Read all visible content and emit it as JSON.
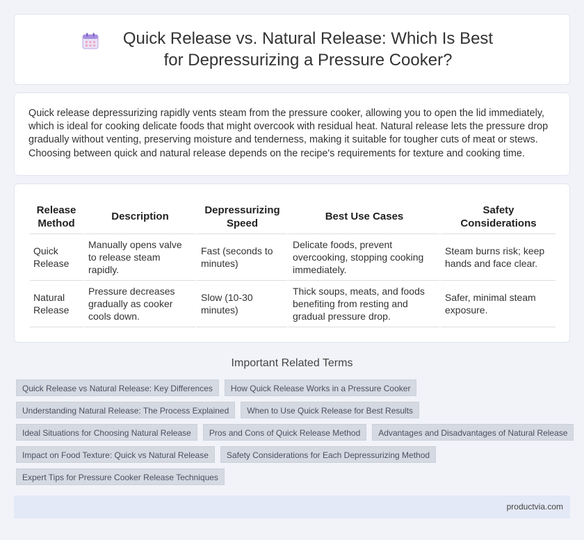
{
  "header": {
    "icon": "calendar-icon",
    "title": "Quick Release vs. Natural Release: Which Is Best for Depressurizing a Pressure Cooker?"
  },
  "intro": {
    "text": "Quick release depressurizing rapidly vents steam from the pressure cooker, allowing you to open the lid immediately, which is ideal for cooking delicate foods that might overcook with residual heat. Natural release lets the pressure drop gradually without venting, preserving moisture and tenderness, making it suitable for tougher cuts of meat or stews. Choosing between quick and natural release depends on the recipe's requirements for texture and cooking time."
  },
  "table": {
    "headers": [
      "Release Method",
      "Description",
      "Depressurizing Speed",
      "Best Use Cases",
      "Safety Considerations"
    ],
    "rows": [
      [
        "Quick Release",
        "Manually opens valve to release steam rapidly.",
        "Fast (seconds to minutes)",
        "Delicate foods, prevent overcooking, stopping cooking immediately.",
        "Steam burns risk; keep hands and face clear."
      ],
      [
        "Natural Release",
        "Pressure decreases gradually as cooker cools down.",
        "Slow (10-30 minutes)",
        "Thick soups, meats, and foods benefiting from resting and gradual pressure drop.",
        "Safer, minimal steam exposure."
      ]
    ]
  },
  "related": {
    "title": "Important Related Terms",
    "rows": [
      [
        "Quick Release vs Natural Release: Key Differences",
        "How Quick Release Works in a Pressure Cooker"
      ],
      [
        "Understanding Natural Release: The Process Explained",
        "When to Use Quick Release for Best Results"
      ],
      [
        "Ideal Situations for Choosing Natural Release",
        "Pros and Cons of Quick Release Method",
        "Advantages and Disadvantages of Natural Release"
      ],
      [
        "Impact on Food Texture: Quick vs Natural Release",
        "Safety Considerations for Each Depressurizing Method"
      ],
      [
        "Expert Tips for Pressure Cooker Release Techniques"
      ]
    ]
  },
  "footer": {
    "site": "productvia.com"
  }
}
